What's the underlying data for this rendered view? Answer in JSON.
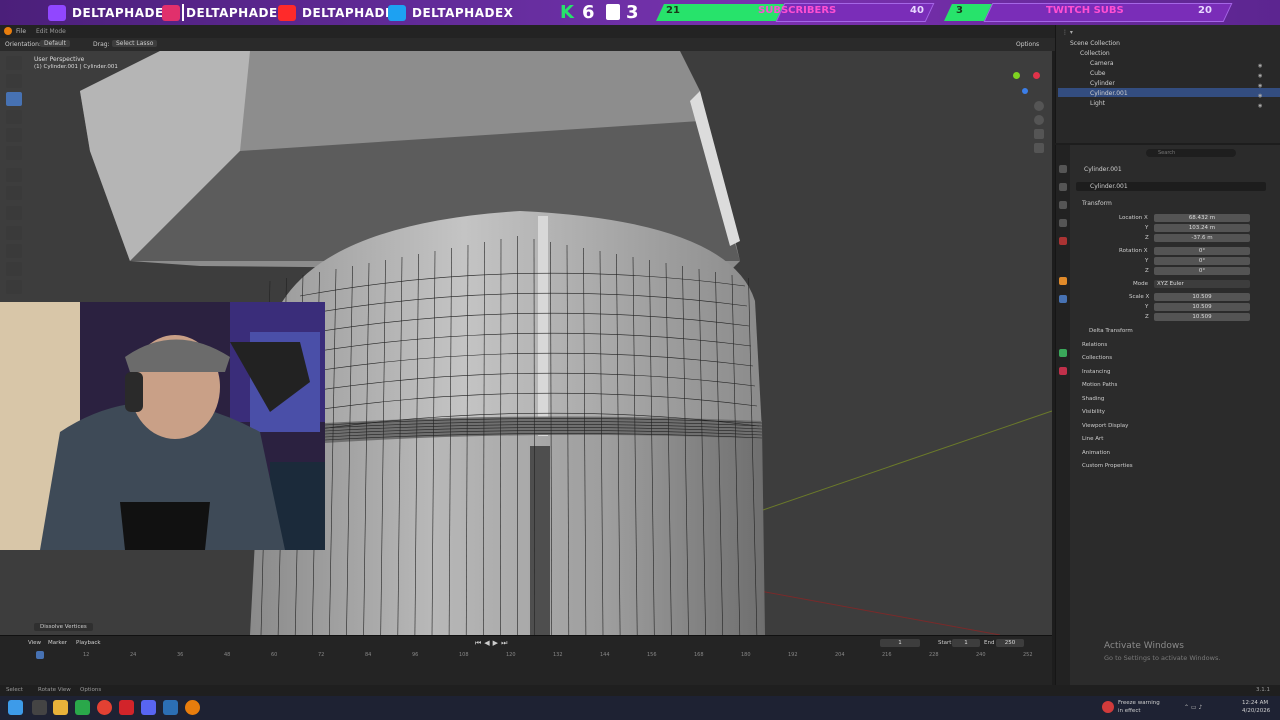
{
  "banner": {
    "handle1": "DELTAPHADE",
    "handle2": "DELTAPHADE",
    "handle3": "DELTAPHADE",
    "handle4": "DELTAPHADEX",
    "k_label": "K",
    "k_num1": "6",
    "k_num2": "3",
    "subs_left": "21",
    "subs_label": "SUBSCRIBERS",
    "subs_goal": "40",
    "twitch_left": "3",
    "twitch_label": "TWITCH SUBS",
    "twitch_goal": "20",
    "colors": {
      "accent": "#9147ff",
      "green": "#27e36b",
      "pink": "#ff4fd2"
    }
  },
  "menubar": {
    "items": [
      "File"
    ],
    "tab": "Edit Mode"
  },
  "header2": {
    "orientation_label": "Orientation:",
    "orientation_value": "Default",
    "drag_label": "Drag:",
    "drag_value": "Select Lasso",
    "options": "Options"
  },
  "viewport": {
    "perspective": "User Perspective",
    "object_line": "(1) Cylinder.001 | Cylinder.001",
    "last_op": "Dissolve Vertices"
  },
  "outliner": {
    "root": "Scene Collection",
    "collection": "Collection",
    "items": [
      "Camera",
      "Cube",
      "Cylinder",
      "Cylinder.001",
      "Light"
    ],
    "selected_index": 3
  },
  "properties": {
    "object_name": "Cylinder.001",
    "mesh_name": "Cylinder.001",
    "panel": "Transform",
    "location_label": "Location X",
    "loc": [
      "68.432 m",
      "103.24 m",
      "-37.6 m"
    ],
    "rotation_label": "Rotation X",
    "rot": [
      "0°",
      "0°",
      "0°"
    ],
    "mode_label": "Mode",
    "mode_value": "XYZ Euler",
    "scale_label": "Scale X",
    "scale": [
      "10.509",
      "10.509",
      "10.509"
    ],
    "y_label": "Y",
    "z_label": "Z",
    "sections": [
      "Delta Transform",
      "Relations",
      "Collections",
      "Instancing",
      "Motion Paths",
      "Shading",
      "Visibility",
      "Viewport Display",
      "Line Art",
      "Animation",
      "Custom Properties"
    ],
    "search_placeholder": "Search"
  },
  "timeline": {
    "menus": [
      "View",
      "Marker",
      "Playback"
    ],
    "frame": "1",
    "start_label": "Start",
    "start": "1",
    "end_label": "End",
    "end": "250",
    "ticks": [
      "0",
      "12",
      "24",
      "36",
      "48",
      "60",
      "72",
      "84",
      "96",
      "108",
      "120",
      "132",
      "144",
      "156",
      "168",
      "180",
      "192",
      "204",
      "216",
      "228",
      "240",
      "252"
    ]
  },
  "statusbar": {
    "select": "Select",
    "rotate": "Rotate View",
    "options": "Options",
    "version": "3.1.1"
  },
  "activate": {
    "title": "Activate Windows",
    "sub": "Go to Settings to activate Windows."
  },
  "taskbar": {
    "notice_title": "Freeze warning",
    "notice_sub": "in effect",
    "time": "12:24 AM",
    "date": "4/20/2026"
  }
}
